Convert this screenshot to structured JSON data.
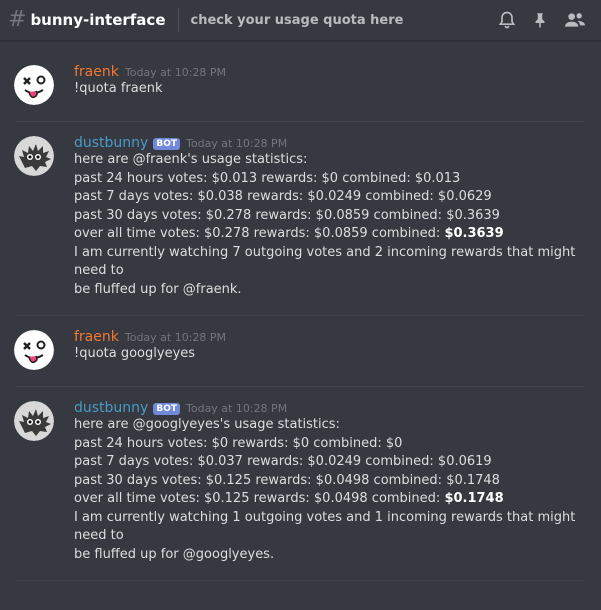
{
  "channel": {
    "hash": "#",
    "name": "bunny-interface",
    "topic": "check your usage quota here"
  },
  "header_icons": [
    "bell-icon",
    "pin-icon",
    "members-icon"
  ],
  "colors": {
    "background": "#36393f",
    "user_name": "#f57731",
    "bot_name": "#4b9ac7",
    "bot_tag": "#7289da"
  },
  "messages": [
    {
      "author": "fraenk",
      "timestamp": "Today at 10:28 PM",
      "lines": [
        "!quota fraenk"
      ]
    },
    {
      "author": "dustbunny",
      "bot_tag": "BOT",
      "timestamp": "Today at 10:28 PM",
      "lines": [
        "here are @fraenk's usage statistics:",
        "past 24 hours votes: $0.013 rewards: $0 combined: $0.013",
        "past 7 days votes: $0.038 rewards: $0.0249 combined: $0.0629",
        "past 30 days votes: $0.278 rewards: $0.0859 combined: $0.3639",
        "over all time votes: $0.278 rewards: $0.0859 combined: ",
        "I am currently watching 7 outgoing votes and 2 incoming rewards that might need to",
        "be fluffed up for @fraenk."
      ],
      "bold_total": "$0.3639"
    },
    {
      "author": "fraenk",
      "timestamp": "Today at 10:28 PM",
      "lines": [
        "!quota googlyeyes"
      ]
    },
    {
      "author": "dustbunny",
      "bot_tag": "BOT",
      "timestamp": "Today at 10:28 PM",
      "lines": [
        "here are @googlyeyes's usage statistics:",
        "past 24 hours votes: $0 rewards: $0 combined: $0",
        "past 7 days votes: $0.037 rewards: $0.0249 combined: $0.0619",
        "past 30 days votes: $0.125 rewards: $0.0498 combined: $0.1748",
        "over all time votes: $0.125 rewards: $0.0498 combined: ",
        "I am currently watching 1 outgoing votes and 1 incoming rewards that might need to",
        "be fluffed up for @googlyeyes."
      ],
      "bold_total": "$0.1748"
    }
  ]
}
